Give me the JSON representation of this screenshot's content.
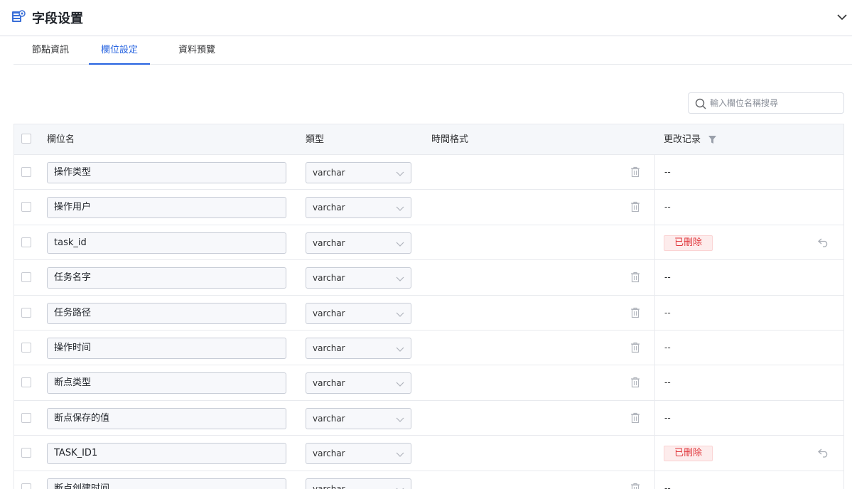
{
  "header": {
    "title": "字段设置",
    "icon": "table-settings-icon",
    "collapse_icon": "chevron-down-icon"
  },
  "tabs": [
    {
      "label": "節點資訊",
      "active": false
    },
    {
      "label": "欄位設定",
      "active": true
    },
    {
      "label": "資料預覽",
      "active": false
    }
  ],
  "search": {
    "placeholder": "輸入欄位名稱搜尋",
    "value": ""
  },
  "table": {
    "columns": {
      "name": "欄位名",
      "type": "類型",
      "time_format": "時間格式",
      "change_log": "更改记录"
    },
    "rows": [
      {
        "name": "操作类型",
        "type": "varchar",
        "status": "--",
        "deleted": false
      },
      {
        "name": "操作用户",
        "type": "varchar",
        "status": "--",
        "deleted": false
      },
      {
        "name": "task_id",
        "type": "varchar",
        "status": "已刪除",
        "deleted": true
      },
      {
        "name": "任务名字",
        "type": "varchar",
        "status": "--",
        "deleted": false
      },
      {
        "name": "任务路径",
        "type": "varchar",
        "status": "--",
        "deleted": false
      },
      {
        "name": "操作时间",
        "type": "varchar",
        "status": "--",
        "deleted": false
      },
      {
        "name": "断点类型",
        "type": "varchar",
        "status": "--",
        "deleted": false
      },
      {
        "name": "断点保存的值",
        "type": "varchar",
        "status": "--",
        "deleted": false
      },
      {
        "name": "TASK_ID1",
        "type": "varchar",
        "status": "已刪除",
        "deleted": true
      },
      {
        "name": "断点创建时间",
        "type": "varchar",
        "status": "--",
        "deleted": false
      }
    ]
  },
  "colors": {
    "accent": "#2663e0",
    "deleted_text": "#e0363b",
    "deleted_bg": "#fdecec"
  }
}
